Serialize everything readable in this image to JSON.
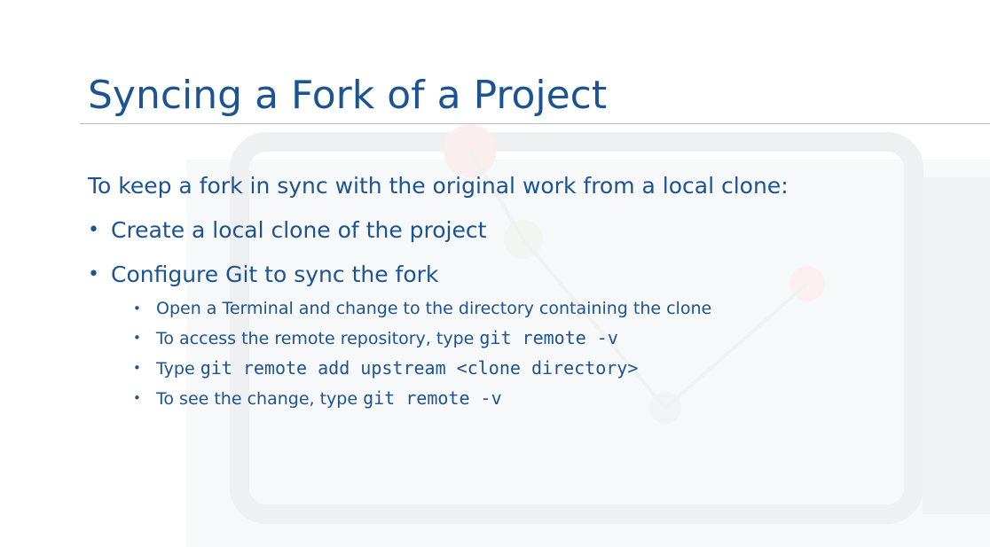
{
  "slide": {
    "title": "Syncing a Fork of a Project",
    "intro": "To keep a fork in sync with the original work from a local clone:",
    "bullets": [
      {
        "text": "Create a local clone of the project"
      },
      {
        "text": "Configure Git to sync the fork"
      }
    ],
    "sub_bullets": [
      {
        "text": "Open a Terminal and change to the directory containing the clone",
        "code": ""
      },
      {
        "text": "To access the remote repository, type ",
        "code": "git remote -v"
      },
      {
        "text": "Type ",
        "code": "git remote add upstream <clone directory>"
      },
      {
        "text": "To see the change, type ",
        "code": "git remote -v"
      }
    ]
  },
  "colors": {
    "text": "#1b5490",
    "rule": "#bfbfbf",
    "background": "#ffffff"
  }
}
